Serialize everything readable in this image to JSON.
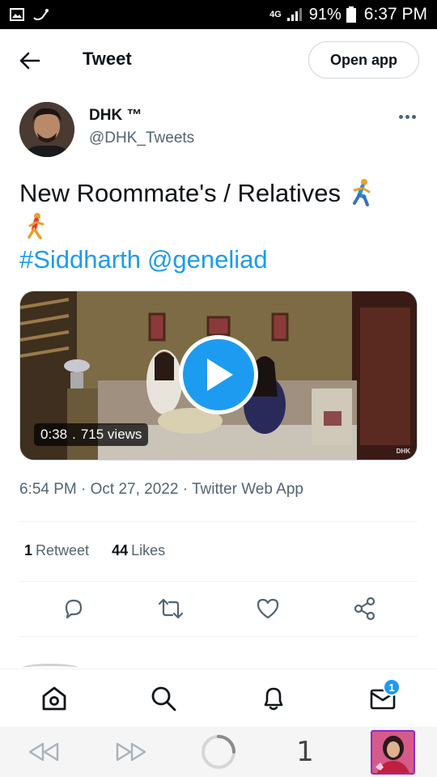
{
  "status_bar": {
    "network": "4G",
    "battery": "91%",
    "time": "6:37 PM"
  },
  "header": {
    "title": "Tweet",
    "open_app_label": "Open app"
  },
  "author": {
    "name": "DHK ™",
    "handle": "@DHK_Tweets"
  },
  "tweet": {
    "text": "New Roommate's / Relatives",
    "hashtag": "#Siddharth",
    "mention": "@geneliad"
  },
  "media": {
    "duration": "0:38",
    "separator": ".",
    "views": "715 views",
    "watermark": "DHK"
  },
  "meta": {
    "timestamp": "6:54 PM · Oct 27, 2022 · Twitter Web App"
  },
  "stats": {
    "retweets_count": "1",
    "retweets_label": "Retweet",
    "likes_count": "44",
    "likes_label": "Likes"
  },
  "actions": [
    "reply-icon",
    "retweet-icon",
    "like-icon",
    "share-icon"
  ],
  "bottom_nav": {
    "items": [
      "home-icon",
      "search-icon",
      "notifications-icon",
      "messages-icon"
    ],
    "messages_badge": "1"
  },
  "browser": {
    "tab_count": "1"
  },
  "colors": {
    "accent": "#1d9bf0",
    "text": "#0f1419",
    "secondary": "#536471",
    "border": "#cfd9de"
  }
}
